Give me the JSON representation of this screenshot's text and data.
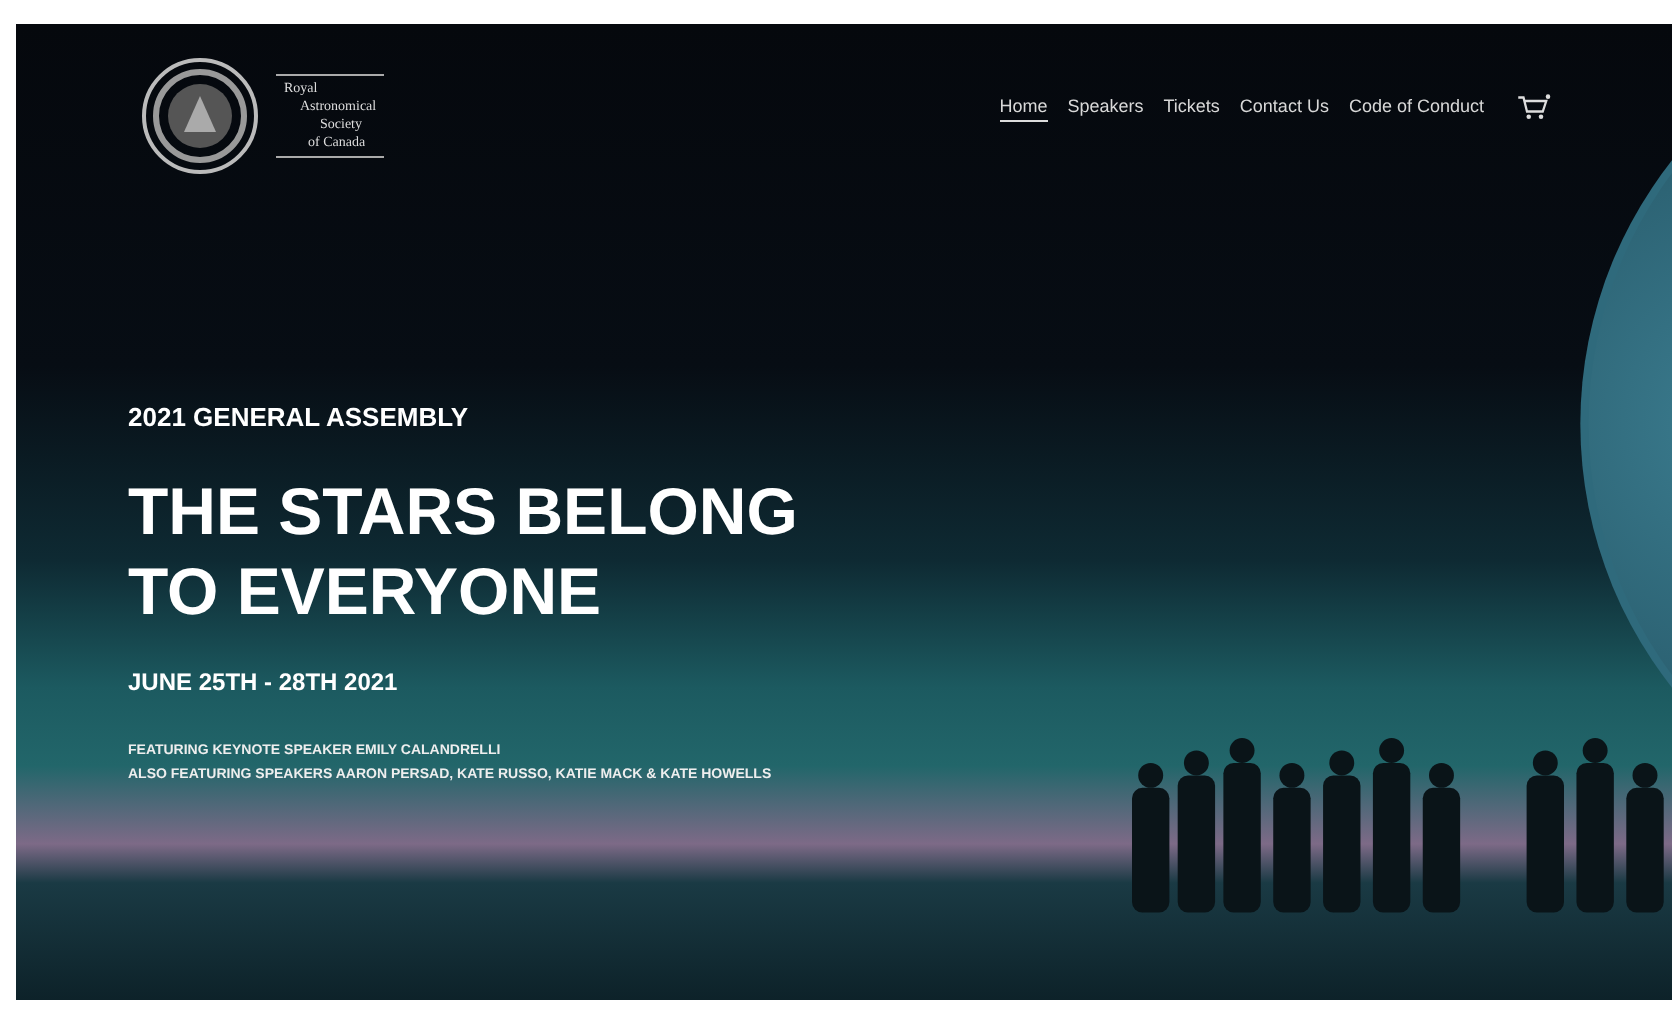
{
  "header": {
    "logo_lines": [
      "Royal",
      "Astronomical",
      "Society",
      "of Canada"
    ],
    "nav": [
      {
        "label": "Home",
        "selected": true
      },
      {
        "label": "Speakers",
        "selected": false
      },
      {
        "label": "Tickets",
        "selected": false
      },
      {
        "label": "Contact Us",
        "selected": false
      },
      {
        "label": "Code of Conduct",
        "selected": false
      }
    ]
  },
  "hero": {
    "eyebrow": "2021 GENERAL ASSEMBLY",
    "title_lines": [
      "THE STARS BELONG",
      "TO EVERYONE"
    ],
    "dates": "JUNE 25TH - 28TH 2021",
    "featuring": [
      "FEATURING KEYNOTE SPEAKER EMILY CALANDRELLI",
      "ALSO FEATURING SPEAKERS AARON PERSAD, KATE RUSSO, KATIE MACK & KATE HOWELLS"
    ]
  }
}
